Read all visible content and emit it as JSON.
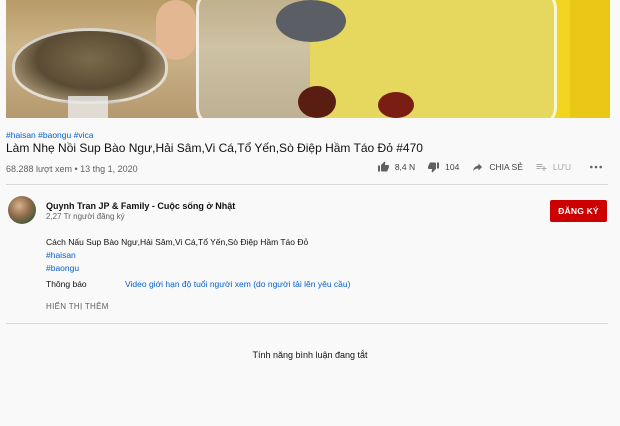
{
  "video": {
    "hashtags": "#haisan #baongu #vica",
    "title": "Làm Nhẹ Nồi Sup Bào Ngư,Hải Sâm,Vi Cá,Tổ Yến,Sò Điệp Hầm Táo Đỏ #470",
    "views_date": "68.288 lượt xem • 13 thg 1, 2020"
  },
  "actions": {
    "like_count": "8,4 N",
    "dislike_count": "104",
    "share_label": "CHIA SẺ",
    "save_label": "LƯU",
    "more_icon": "more-dots-icon"
  },
  "channel": {
    "name": "Quynh Tran JP & Family - Cuộc sống ở Nhật",
    "subscribers": "2,27 Tr người đăng ký",
    "subscribe_label": "ĐĂNG KÝ"
  },
  "description": {
    "text": "Cách Nấu Sup Bào Ngư,Hải Sâm,Vi Cá,Tổ Yến,Sò Điệp Hầm Táo Đỏ",
    "hashtags": [
      "#haisan",
      "#baongu"
    ],
    "notice_label": "Thông báo",
    "notice_text": "Video giới hạn độ tuổi người xem (do người tải lên yêu cầu)",
    "show_more": "HIỂN THỊ THÊM"
  },
  "comments": {
    "status": "Tính năng bình luận đang tắt"
  },
  "colors": {
    "link": "#065fd4",
    "subscribe": "#cc0000",
    "secondary_text": "#606060"
  }
}
